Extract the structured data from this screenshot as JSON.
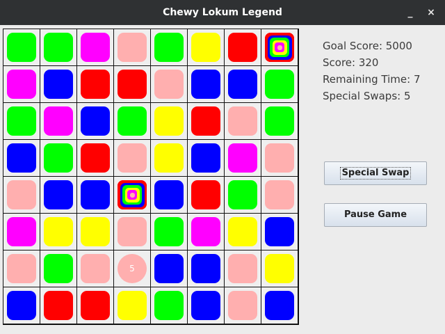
{
  "window": {
    "title": "Chewy Lokum Legend",
    "minimize_glyph": "_",
    "close_glyph": "×"
  },
  "stats": {
    "goal_score": "Goal Score: 5000",
    "score": "Score: 320",
    "remaining_time": "Remaining Time: 7",
    "special_swaps": "Special Swaps: 5"
  },
  "buttons": {
    "special_swap": "Special Swap",
    "pause_game": "Pause Game"
  },
  "colors": {
    "G": "#00ff00",
    "M": "#ff00ff",
    "P": "#ffafaf",
    "R": "#ff0000",
    "Y": "#ffff00",
    "B": "#0000ff"
  },
  "board": {
    "rows": [
      [
        "G",
        "G",
        "M",
        "P",
        "G",
        "Y",
        "R",
        "S"
      ],
      [
        "M",
        "B",
        "R",
        "R",
        "P",
        "B",
        "B",
        "G"
      ],
      [
        "G",
        "M",
        "B",
        "G",
        "Y",
        "R",
        "P",
        "G"
      ],
      [
        "B",
        "G",
        "R",
        "P",
        "Y",
        "B",
        "M",
        "P"
      ],
      [
        "P",
        "B",
        "B",
        "S",
        "B",
        "R",
        "G",
        "P"
      ],
      [
        "M",
        "Y",
        "Y",
        "P",
        "G",
        "M",
        "Y",
        "B"
      ],
      [
        "P",
        "G",
        "P",
        "T",
        "B",
        "B",
        "P",
        "Y"
      ],
      [
        "B",
        "R",
        "R",
        "Y",
        "G",
        "B",
        "P",
        "B"
      ]
    ],
    "timed_candy_value": "5",
    "legend": {
      "S": "special-striped-candy",
      "T": "timed-candy"
    }
  }
}
